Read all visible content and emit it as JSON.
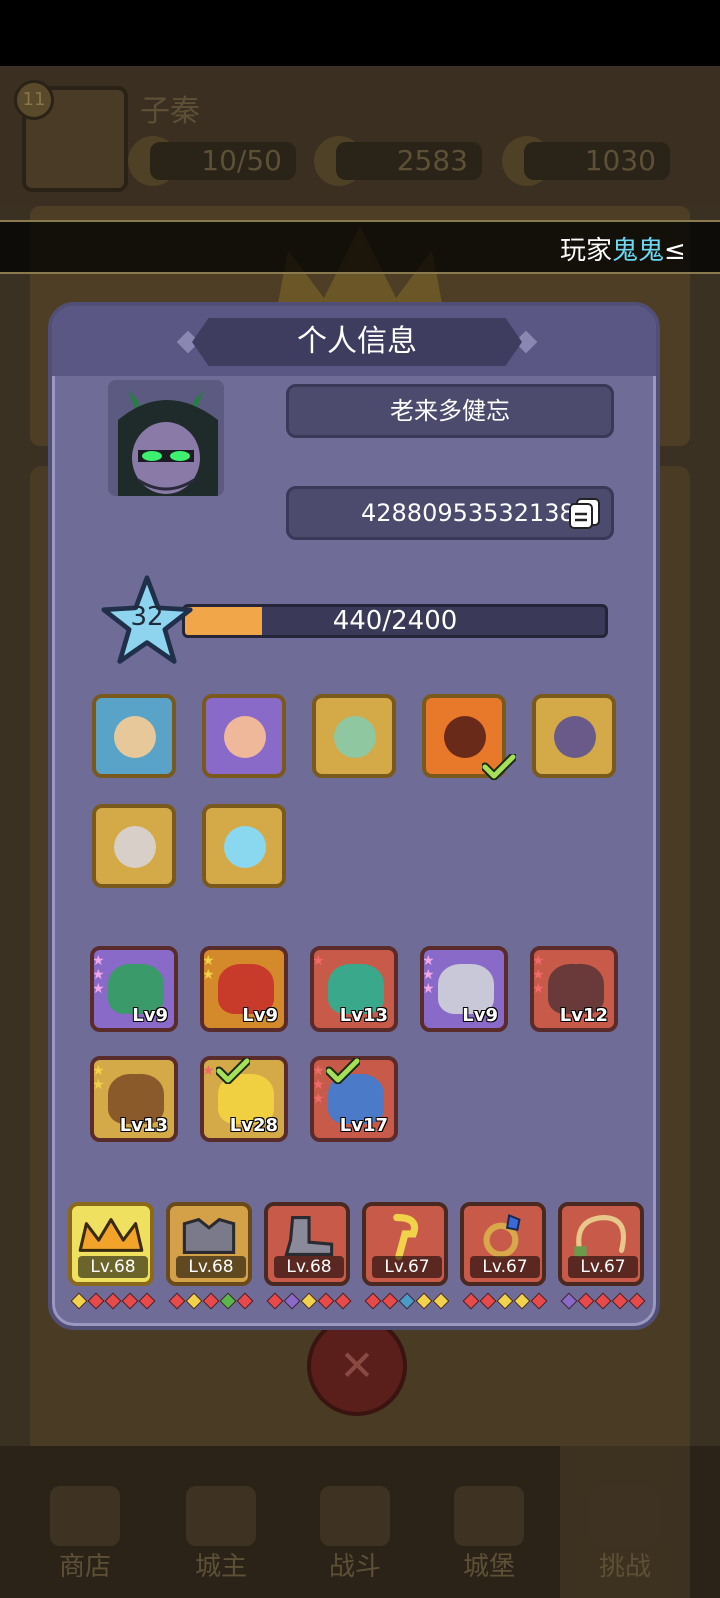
{
  "background": {
    "player_level": "11",
    "player_name": "子秦",
    "energy": "10/50",
    "gems": "2583",
    "gold": "1030",
    "nav": [
      "商店",
      "城主",
      "战斗",
      "城堡",
      "挑战"
    ]
  },
  "banner": {
    "prefix": "玩家",
    "highlight": "鬼鬼",
    "suffix": "≤"
  },
  "dialog": {
    "title": "个人信息",
    "nickname": "老来多健忘",
    "player_id": "42880953532138",
    "level": "32",
    "exp_text": "440/2400",
    "exp_progress": 0.183
  },
  "heroes": [
    {
      "name": "elf-ranger",
      "bg": "#5aa3c8",
      "face": "#e6c89a",
      "checked": false
    },
    {
      "name": "red-sorceress",
      "bg": "#8a6ac8",
      "face": "#f0b89a",
      "checked": false
    },
    {
      "name": "green-elf",
      "bg": "#d4aa48",
      "face": "#8fc7a0",
      "checked": false
    },
    {
      "name": "fire-demon",
      "bg": "#e8792a",
      "face": "#6a2a1a",
      "checked": true
    },
    {
      "name": "demon-hunter",
      "bg": "#d4aa48",
      "face": "#6a5a8a",
      "checked": false
    },
    {
      "name": "old-wizard",
      "bg": "#d4aa48",
      "face": "#d8d0c8",
      "checked": false
    },
    {
      "name": "skeleton-king",
      "bg": "#d4aa48",
      "face": "#8ad8f0",
      "checked": false
    }
  ],
  "pets": [
    {
      "name": "green-dragon",
      "bg": "#8a6ac8",
      "body": "#3a9a6a",
      "lv": "Lv9",
      "stars": 3,
      "star_color": "#f0a8e8",
      "checked": false
    },
    {
      "name": "red-dragon",
      "bg": "#d48a2a",
      "body": "#c83a2a",
      "lv": "Lv9",
      "stars": 2,
      "star_color": "#f2d24a",
      "checked": false
    },
    {
      "name": "teal-dragon",
      "bg": "#c85a4a",
      "body": "#3aa88a",
      "lv": "Lv13",
      "stars": 1,
      "star_color": "#f06a6a",
      "checked": false
    },
    {
      "name": "silver-golem",
      "bg": "#8a6ac8",
      "body": "#c8c8d8",
      "lv": "Lv9",
      "stars": 3,
      "star_color": "#f0a8e8",
      "checked": false
    },
    {
      "name": "dark-dragon",
      "bg": "#c85a4a",
      "body": "#6a3a3a",
      "lv": "Lv12",
      "stars": 3,
      "star_color": "#f06a6a",
      "checked": false
    },
    {
      "name": "tree-treant",
      "bg": "#d4aa48",
      "body": "#8a5a2a",
      "lv": "Lv13",
      "stars": 2,
      "star_color": "#f2d24a",
      "checked": false
    },
    {
      "name": "gold-beast",
      "bg": "#d4aa48",
      "body": "#f0d040",
      "lv": "Lv28",
      "stars": 1,
      "star_color": "#f06a6a",
      "checked": true
    },
    {
      "name": "ice-dragon",
      "bg": "#c85a4a",
      "body": "#4a7ac8",
      "lv": "Lv17",
      "stars": 3,
      "star_color": "#f06a6a",
      "checked": true
    }
  ],
  "equipment": [
    {
      "name": "crown",
      "bg": "#f0e060",
      "border": "#8a6a1a",
      "icon": "#f2a42a",
      "lv": "Lv.68",
      "gems": [
        "#f2d24a",
        "#e84a4a",
        "#e84a4a",
        "#e84a4a",
        "#e84a4a"
      ]
    },
    {
      "name": "armor",
      "bg": "#d4a048",
      "border": "#6a4a1a",
      "icon": "#7a7a8a",
      "lv": "Lv.68",
      "gems": [
        "#e84a4a",
        "#f2d24a",
        "#e84a4a",
        "#5ab84a",
        "#e84a4a"
      ]
    },
    {
      "name": "boots",
      "bg": "#c85a4a",
      "border": "#4a2a20",
      "icon": "#8a8a9a",
      "lv": "Lv.68",
      "gems": [
        "#e84a4a",
        "#8a6ac8",
        "#f2d24a",
        "#e84a4a",
        "#e84a4a"
      ]
    },
    {
      "name": "staff",
      "bg": "#c85a4a",
      "border": "#4a2a20",
      "icon": "#f2d24a",
      "lv": "Lv.67",
      "gems": [
        "#e84a4a",
        "#e84a4a",
        "#4a9ac8",
        "#f2d24a",
        "#f2d24a"
      ]
    },
    {
      "name": "ring",
      "bg": "#c85a4a",
      "border": "#4a2a20",
      "icon": "#d8a84a",
      "lv": "Lv.67",
      "gems": [
        "#e84a4a",
        "#e84a4a",
        "#f2d24a",
        "#f2d24a",
        "#e84a4a"
      ]
    },
    {
      "name": "whip",
      "bg": "#c85a4a",
      "border": "#4a2a20",
      "icon": "#e8c88a",
      "lv": "Lv.67",
      "gems": [
        "#8a6ac8",
        "#e84a4a",
        "#e84a4a",
        "#e84a4a",
        "#e84a4a"
      ]
    }
  ]
}
